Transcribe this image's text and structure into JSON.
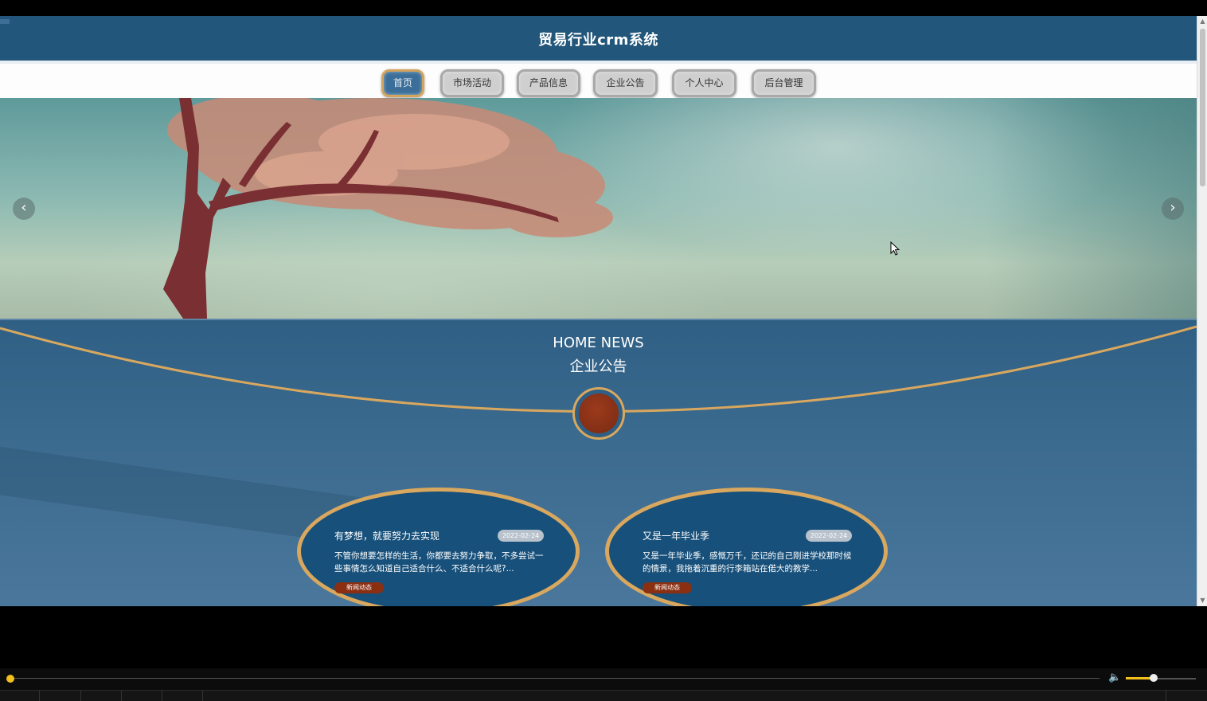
{
  "site": {
    "title": "贸易行业crm系统"
  },
  "nav": {
    "items": [
      {
        "label": "首页",
        "active": true
      },
      {
        "label": "市场活动",
        "active": false
      },
      {
        "label": "产品信息",
        "active": false
      },
      {
        "label": "企业公告",
        "active": false
      },
      {
        "label": "个人中心",
        "active": false
      },
      {
        "label": "后台管理",
        "active": false
      }
    ]
  },
  "banner": {
    "prev_icon": "chevron-left-icon",
    "next_icon": "chevron-right-icon",
    "prev_glyph": "‹",
    "next_glyph": "›"
  },
  "news": {
    "heading_en": "HOME NEWS",
    "heading_cn": "企业公告",
    "cards": [
      {
        "title": "有梦想，就要努力去实现",
        "date": "2022-02-24",
        "desc": "不管你想要怎样的生活，你都要去努力争取，不多尝试一些事情怎么知道自己适合什么、不适合什么呢?...",
        "tag": "新闻动态"
      },
      {
        "title": "又是一年毕业季",
        "date": "2022-02-24",
        "desc": "又是一年毕业季，感慨万千，还记的自己刚进学校那时候的情景，我拖着沉重的行李箱站在偌大的教学...",
        "tag": "新闻动态"
      }
    ]
  },
  "player": {
    "progress": 0.0,
    "volume": 0.4,
    "volume_icon": "speaker-icon"
  },
  "colors": {
    "header_bg": "#22567a",
    "accent_gold": "#d9a85e",
    "card_bg": "#17507a",
    "tag_bg": "#8a2f12",
    "player_accent": "#f2c01c"
  }
}
